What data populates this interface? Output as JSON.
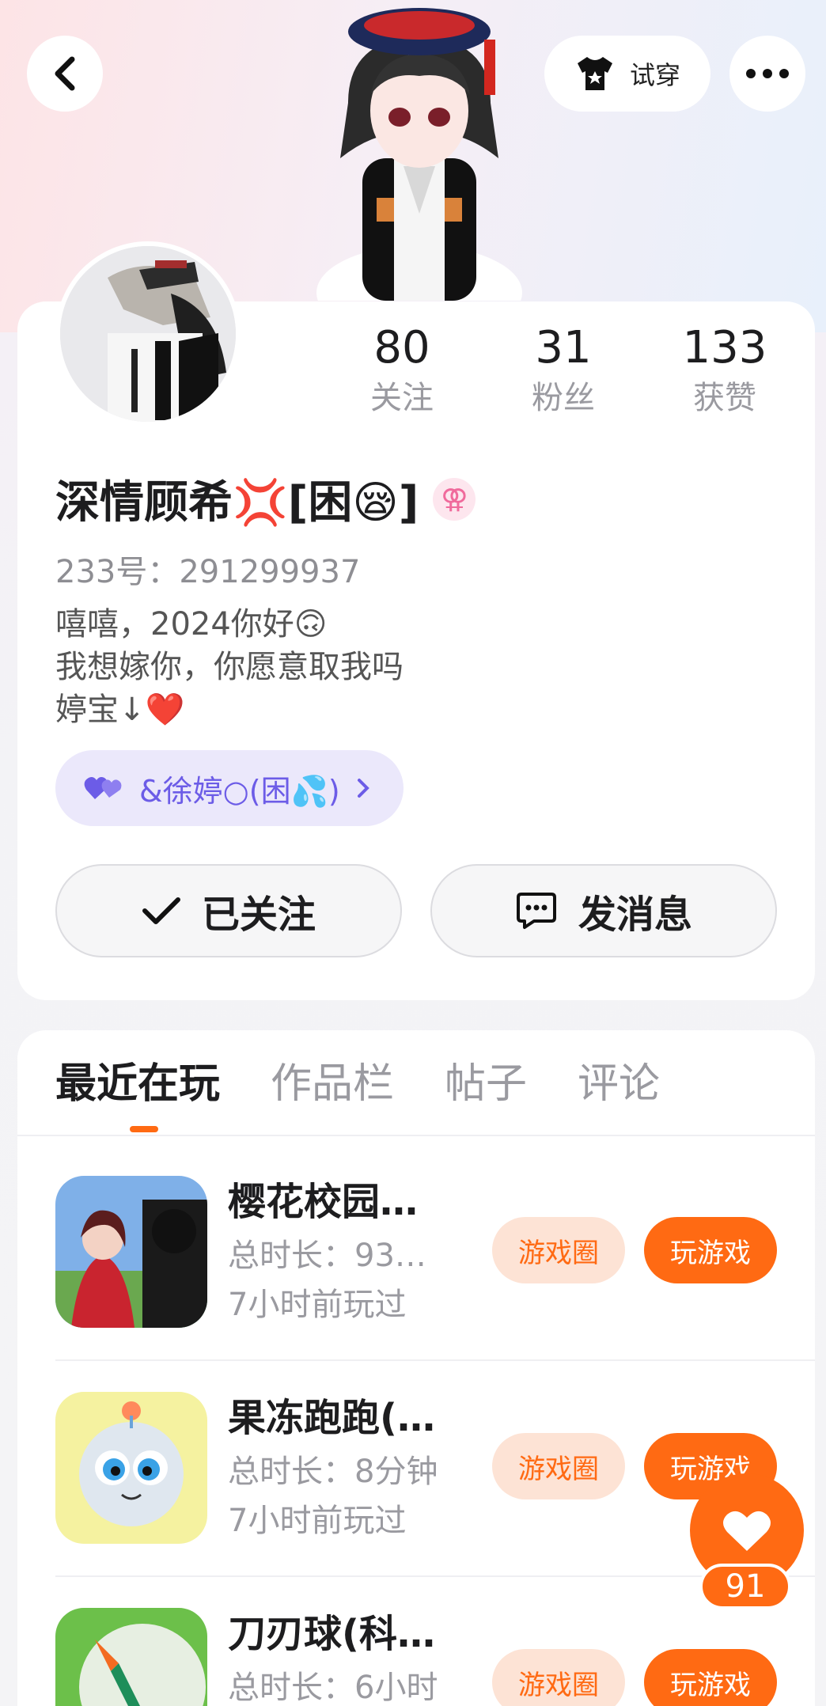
{
  "header": {
    "try_on_label": "试穿"
  },
  "profile": {
    "stats": [
      {
        "value": "80",
        "label": "关注"
      },
      {
        "value": "31",
        "label": "粉丝"
      },
      {
        "value": "133",
        "label": "获赞"
      }
    ],
    "name": "深情顾希💢[困😪]",
    "gender_symbol": "⚢",
    "uid": "233号：291299937",
    "bio_lines": [
      "嘻嘻，2024你好🙃",
      "我想嫁你，你愿意取我吗",
      "婷宝↓❤️"
    ],
    "relation_tag": "&徐婷○(困💦)",
    "follow_label": "已关注",
    "message_label": "发消息"
  },
  "tabs": [
    "最近在玩",
    "作品栏",
    "帖子",
    "评论"
  ],
  "games": [
    {
      "title": "樱花校园…",
      "duration": "总时长：93…",
      "last_played": "7小时前玩过",
      "circle_label": "游戏圈",
      "play_label": "玩游戏"
    },
    {
      "title": "果冻跑跑(…",
      "duration": "总时长：8分钟",
      "last_played": "7小时前玩过",
      "circle_label": "游戏圈",
      "play_label": "玩游戏"
    },
    {
      "title": "刀刃球(科…",
      "duration": "总时长：6小时",
      "last_played": "",
      "circle_label": "游戏圈",
      "play_label": "玩游戏"
    }
  ],
  "like_count": "91",
  "colors": {
    "accent": "#ff6a13",
    "accent_light": "#fde3d5",
    "tag_bg": "#ebe8fb",
    "tag_text": "#6c5ce7"
  }
}
